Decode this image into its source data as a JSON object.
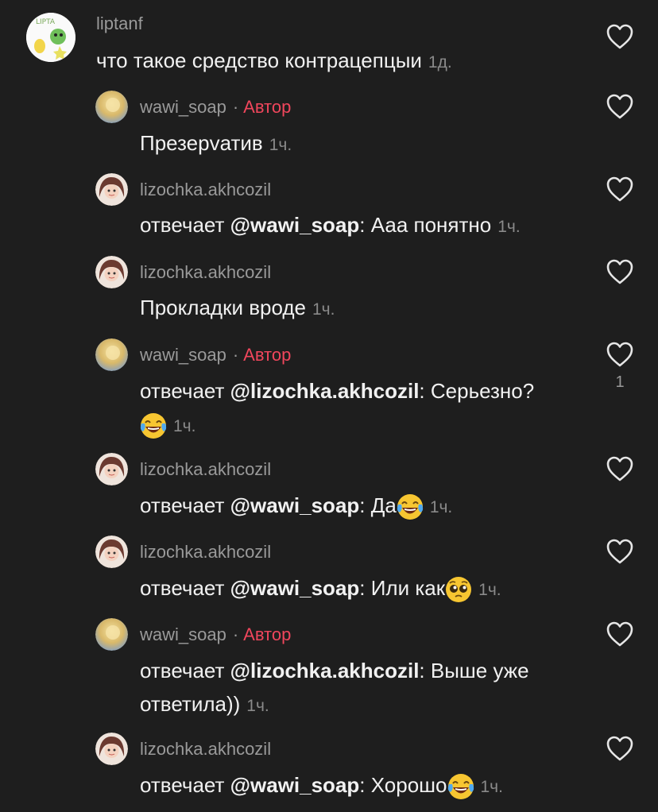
{
  "comments": [
    {
      "user": "liptanf",
      "author": false,
      "text": "что такое средство контрацепцыи",
      "time": "1д."
    },
    {
      "user": "wawi_soap",
      "author": true,
      "author_label": "Автор",
      "text": "Презерvатив",
      "time": "1ч."
    },
    {
      "user": "lizochka.akhcozil",
      "prefix": "отвечает ",
      "mention": "@wawi_soap",
      "text": ": Ааа понятно",
      "time": "1ч."
    },
    {
      "user": "lizochka.akhcozil",
      "text": "Прокладки вроде",
      "time": "1ч."
    },
    {
      "user": "wawi_soap",
      "author": true,
      "author_label": "Автор",
      "prefix": "отвечает ",
      "mention": "@lizochka.akhcozil",
      "text": ": Серьезно?",
      "time": "1ч.",
      "likes": "1"
    },
    {
      "user": "lizochka.akhcozil",
      "prefix": "отвечает ",
      "mention": "@wawi_soap",
      "text": ": Да",
      "time": "1ч."
    },
    {
      "user": "lizochka.akhcozil",
      "prefix": "отвечает ",
      "mention": "@wawi_soap",
      "text": ": Или как",
      "time": "1ч."
    },
    {
      "user": "wawi_soap",
      "author": true,
      "author_label": "Автор",
      "prefix": "отвечает ",
      "mention": "@lizochka.akhcozil",
      "text": ": Выше уже",
      "text2": "ответила))",
      "time": "1ч."
    },
    {
      "user": "lizochka.akhcozil",
      "prefix": "отвечает ",
      "mention": "@wawi_soap",
      "text": ": Хорошо",
      "time": "1ч."
    }
  ],
  "colors": {
    "background": "#1e1e1e",
    "author": "#f0465c",
    "username": "#9a9a9a",
    "text": "#f1f1f1"
  },
  "icons": {
    "like": "heart-outline-icon",
    "laugh": "face-with-tears-of-joy-emoji",
    "pleading": "pleading-face-emoji"
  }
}
